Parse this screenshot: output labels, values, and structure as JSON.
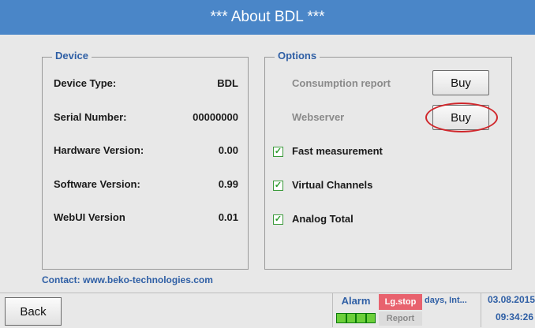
{
  "window": {
    "title": "***  About BDL  ***"
  },
  "device": {
    "legend": "Device",
    "rows": [
      {
        "label": "Device Type:",
        "value": "BDL"
      },
      {
        "label": "Serial Number:",
        "value": "00000000"
      },
      {
        "label": "Hardware Version:",
        "value": "0.00"
      },
      {
        "label": "Software Version:",
        "value": "0.99"
      },
      {
        "label": "WebUI Version",
        "value": "0.01"
      }
    ]
  },
  "options": {
    "legend": "Options",
    "buy_items": [
      {
        "label": "Consumption report",
        "button": "Buy"
      },
      {
        "label": "Webserver",
        "button": "Buy"
      }
    ],
    "checked_items": [
      {
        "label": "Fast measurement",
        "checked": true
      },
      {
        "label": "Virtual Channels",
        "checked": true
      },
      {
        "label": "Analog Total",
        "checked": true
      }
    ]
  },
  "contact": "Contact: www.beko-technologies.com",
  "footer": {
    "back": "Back",
    "alarm": "Alarm",
    "lg_stop": "Lg.stop",
    "report": "Report",
    "days": "days, Int...",
    "date": "03.08.2015",
    "time": "09:34:26"
  },
  "colors": {
    "title_bar": "#4a86c8",
    "accent_text": "#2f5fa5",
    "highlight": "#d0262b",
    "lg_stop": "#e8626e",
    "alarm_ok": "#6ccf3a"
  },
  "icons": {
    "check": "check-mark-icon"
  }
}
